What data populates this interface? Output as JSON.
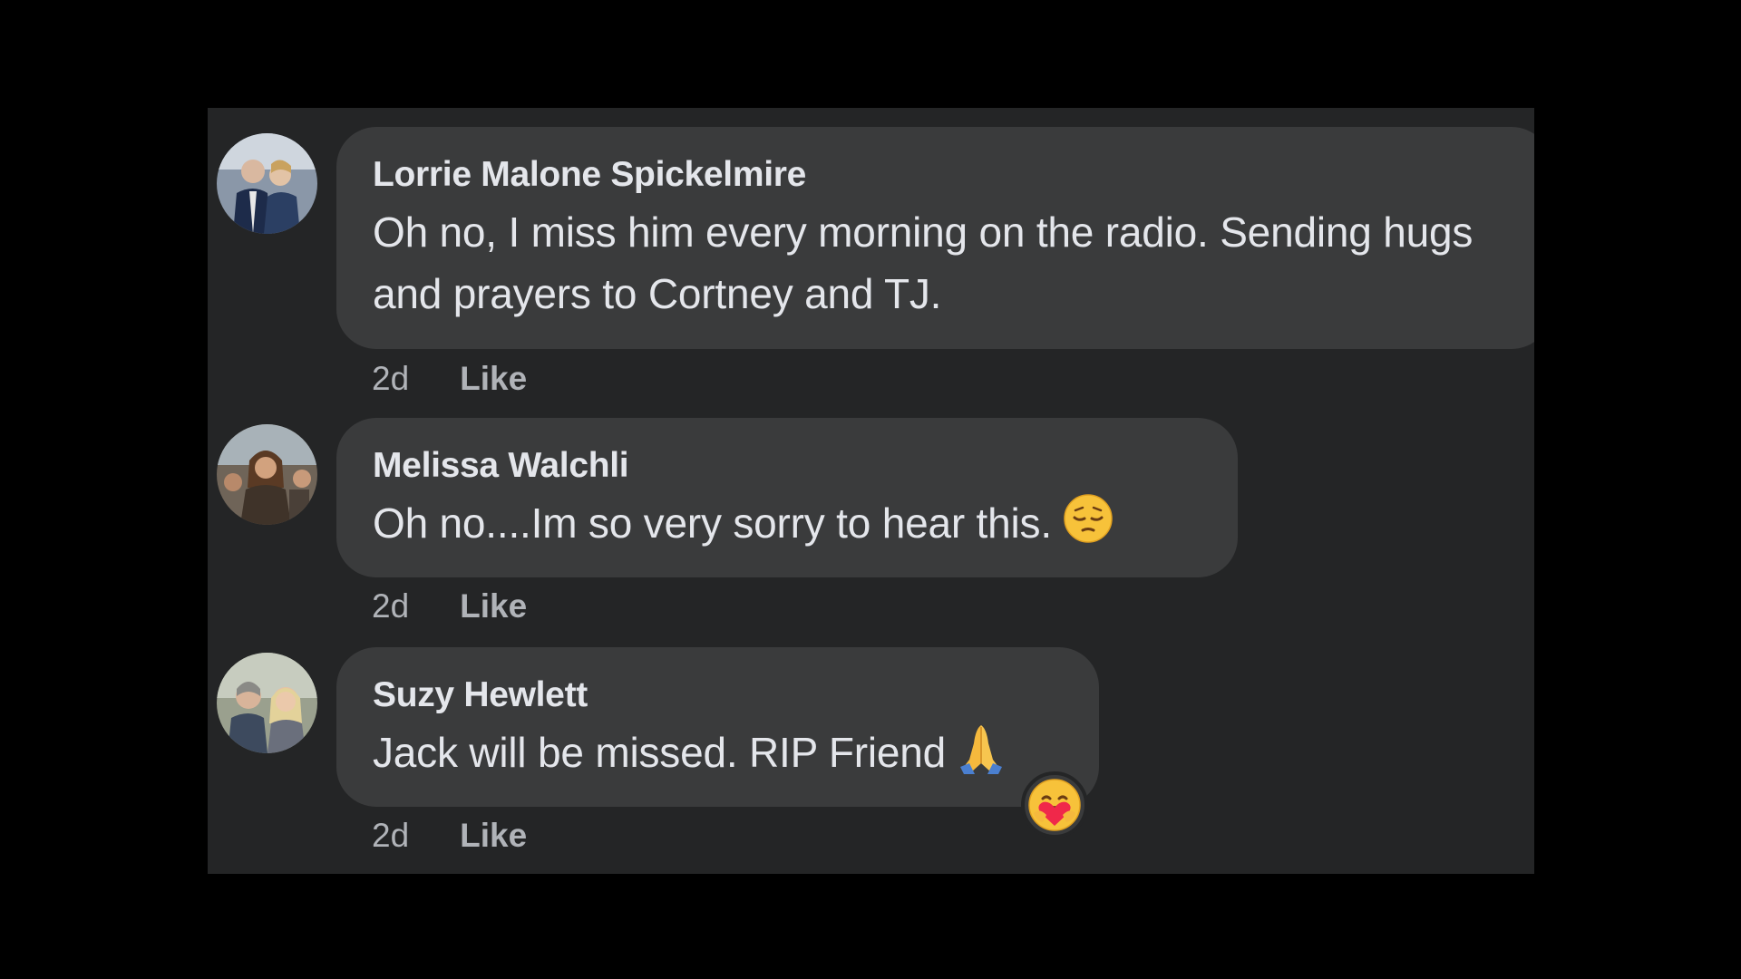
{
  "comments": [
    {
      "author": "Lorrie Malone Spickelmire",
      "text": "Oh no, I miss him every morning on the radio. Sending hugs and prayers to Cortney and TJ.",
      "time": "2d",
      "like_label": "Like",
      "avatar_icon": "profile-photo-icon"
    },
    {
      "author": "Melissa Walchli",
      "text": "Oh no....Im so very sorry to hear this.",
      "emoji": "pensive-face-icon",
      "time": "2d",
      "like_label": "Like",
      "avatar_icon": "profile-photo-icon"
    },
    {
      "author": "Suzy Hewlett",
      "text": "Jack will be missed. RIP Friend",
      "emoji": "folded-hands-icon",
      "time": "2d",
      "like_label": "Like",
      "avatar_icon": "profile-photo-icon",
      "reaction": "care-reaction-icon"
    }
  ],
  "colors": {
    "page_background": "#000000",
    "panel_background": "#242526",
    "bubble_background": "#3a3b3c",
    "primary_text": "#e4e6eb",
    "secondary_text": "#b0b3b8"
  }
}
